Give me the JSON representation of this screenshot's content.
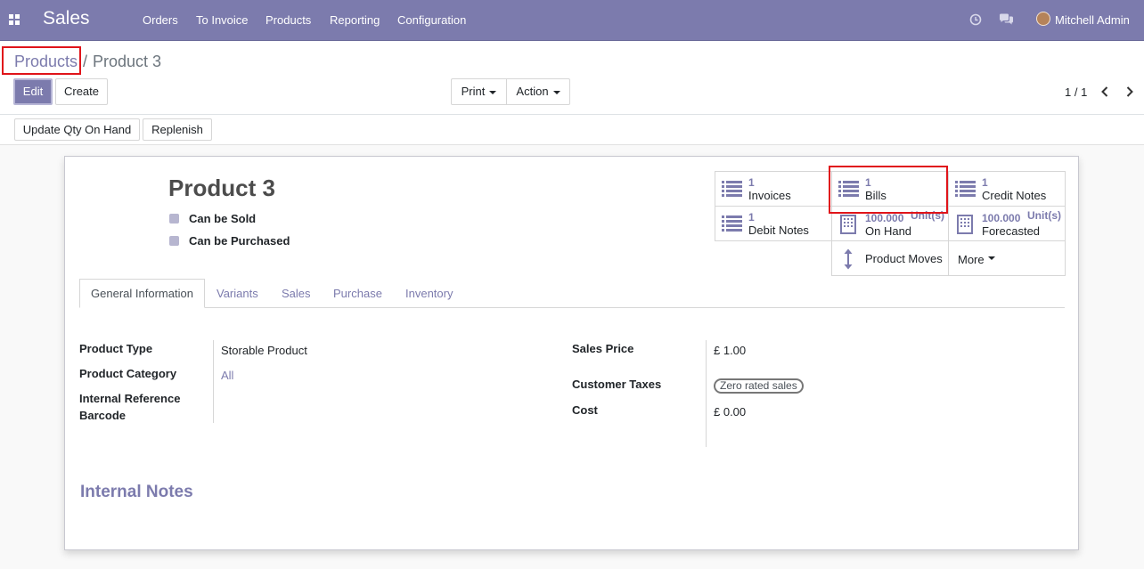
{
  "topbar": {
    "app_name": "Sales",
    "menu": [
      "Orders",
      "To Invoice",
      "Products",
      "Reporting",
      "Configuration"
    ],
    "user": "Mitchell Admin",
    "color": "#7c7bad"
  },
  "breadcrumb": {
    "parent": "Products",
    "separator": "/",
    "current": "Product 3"
  },
  "buttons": {
    "edit": "Edit",
    "create": "Create",
    "print": "Print",
    "action": "Action",
    "update_qty": "Update Qty On Hand",
    "replenish": "Replenish"
  },
  "pager": {
    "value": "1 / 1"
  },
  "product": {
    "name": "Product 3",
    "can_be_sold": "Can be Sold",
    "can_be_purchased": "Can be Purchased"
  },
  "smart_buttons": {
    "invoices": {
      "count": "1",
      "label": "Invoices"
    },
    "bills": {
      "count": "1",
      "label": "Bills"
    },
    "credit_notes": {
      "count": "1",
      "label": "Credit Notes"
    },
    "debit_notes": {
      "count": "1",
      "label": "Debit Notes"
    },
    "on_hand": {
      "value": "100.000",
      "unit": "Unit(s)",
      "label": "On Hand"
    },
    "forecasted": {
      "value": "100.000",
      "unit": "Unit(s)",
      "label": "Forecasted"
    },
    "product_moves": {
      "label": "Product Moves"
    },
    "more": {
      "label": "More"
    }
  },
  "tabs": [
    "General Information",
    "Variants",
    "Sales",
    "Purchase",
    "Inventory"
  ],
  "fields": {
    "product_type": {
      "label": "Product Type",
      "value": "Storable Product"
    },
    "product_category": {
      "label": "Product Category",
      "value": "All"
    },
    "internal_reference": {
      "label": "Internal Reference"
    },
    "barcode": {
      "label": "Barcode"
    },
    "sales_price": {
      "label": "Sales Price",
      "value": "£ 1.00"
    },
    "customer_taxes": {
      "label": "Customer Taxes",
      "value": "Zero rated sales"
    },
    "cost": {
      "label": "Cost",
      "value": "£ 0.00"
    }
  },
  "internal_notes": {
    "title": "Internal Notes"
  }
}
